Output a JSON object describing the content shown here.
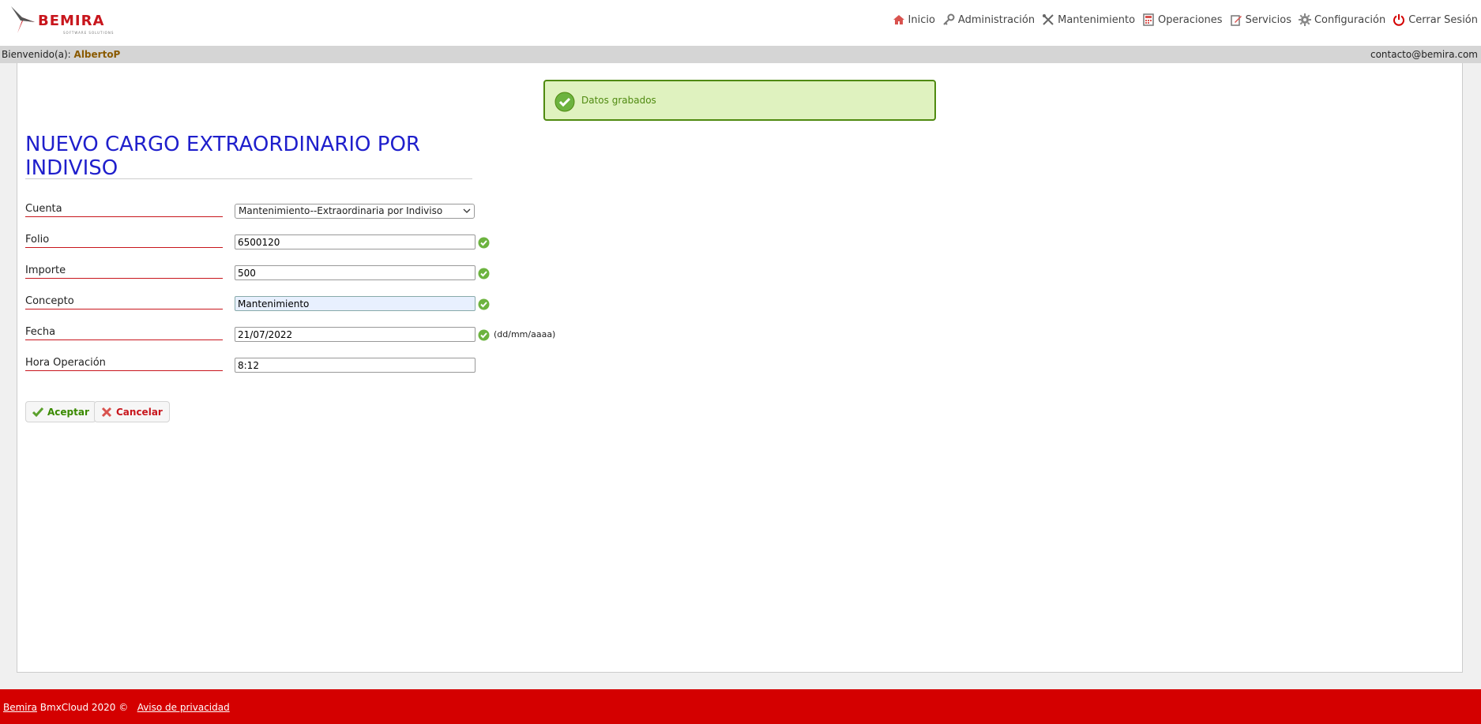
{
  "brand": {
    "logo_text": "BEMIRA",
    "logo_sub": "SOFTWARE SOLUTIONS"
  },
  "nav": [
    {
      "label": "Inicio",
      "icon": "home-icon"
    },
    {
      "label": "Administración",
      "icon": "key-icon"
    },
    {
      "label": "Mantenimiento",
      "icon": "tools-icon"
    },
    {
      "label": "Operaciones",
      "icon": "calculator-icon"
    },
    {
      "label": "Servicios",
      "icon": "edit-icon"
    },
    {
      "label": "Configuración",
      "icon": "gear-icon"
    },
    {
      "label": "Cerrar Sesión",
      "icon": "power-icon"
    }
  ],
  "welcome": {
    "prefix": "Bienvenido(a):",
    "user": "AlbertoP",
    "contact": "contacto@bemira.com"
  },
  "alert": {
    "text": "Datos grabados"
  },
  "form": {
    "title": "NUEVO CARGO EXTRAORDINARIO POR INDIVISO",
    "fields": {
      "cuenta": {
        "label": "Cuenta",
        "value": "Mantenimiento--Extraordinaria por Indiviso"
      },
      "folio": {
        "label": "Folio",
        "value": "6500120"
      },
      "importe": {
        "label": "Importe",
        "value": "500"
      },
      "concepto": {
        "label": "Concepto",
        "value": "Mantenimiento"
      },
      "fecha": {
        "label": "Fecha",
        "value": "21/07/2022",
        "hint": "(dd/mm/aaaa)"
      },
      "hora": {
        "label": "Hora Operación",
        "value": "8:12"
      }
    },
    "accept_label": "Aceptar",
    "cancel_label": "Cancelar"
  },
  "footer": {
    "brand_link": "Bemira",
    "text": "BmxCloud 2020 ©",
    "privacy_link": "Aviso de privacidad"
  },
  "colors": {
    "accent_red": "#d40000",
    "title_blue": "#1f1fcc",
    "success_green": "#4f8a10"
  }
}
